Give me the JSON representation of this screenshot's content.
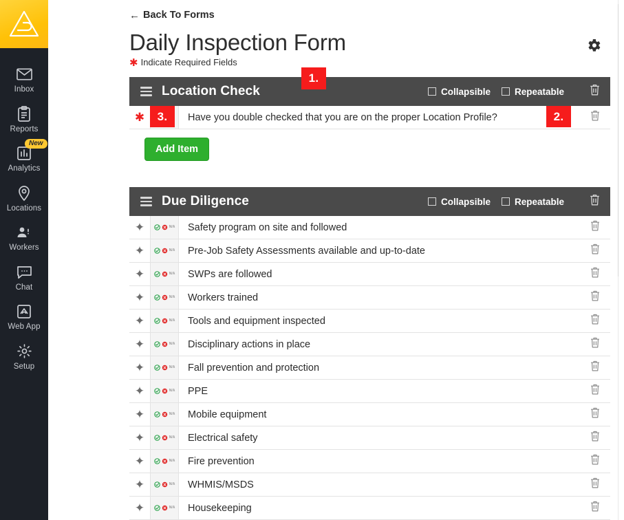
{
  "sidebar": {
    "logo_name": "brand-logo",
    "items": [
      {
        "label": "Inbox",
        "icon": "envelope-icon",
        "badge": null
      },
      {
        "label": "Reports",
        "icon": "clipboard-icon",
        "badge": null
      },
      {
        "label": "Analytics",
        "icon": "bar-chart-icon",
        "badge": "New"
      },
      {
        "label": "Locations",
        "icon": "map-pin-icon",
        "badge": null
      },
      {
        "label": "Workers",
        "icon": "people-icon",
        "badge": null
      },
      {
        "label": "Chat",
        "icon": "chat-bubble-icon",
        "badge": null
      },
      {
        "label": "Web App",
        "icon": "web-app-icon",
        "badge": null
      },
      {
        "label": "Setup",
        "icon": "gear-icon",
        "badge": null
      }
    ]
  },
  "header": {
    "back_label": "Back To Forms",
    "title": "Daily Inspection Form",
    "required_note": "Indicate Required Fields",
    "required_star": "✱",
    "settings_icon": "gear-icon"
  },
  "common": {
    "collapsible_label": "Collapsible",
    "repeatable_label": "Repeatable",
    "yes_label": "Yes",
    "no_label": "No",
    "na_label": "N/A",
    "add_item_label": "Add Item"
  },
  "sections": [
    {
      "title": "Location Check",
      "collapsible_checked": false,
      "repeatable_checked": false,
      "items": [
        {
          "label": "Have you double checked that you are on the proper Location Profile?",
          "required": true,
          "answer_type": "yes-no-na-text"
        }
      ],
      "show_add_item": true
    },
    {
      "title": "Due Diligence",
      "collapsible_checked": false,
      "repeatable_checked": false,
      "items": [
        {
          "label": "Safety program on site and followed",
          "required": false,
          "answer_type": "yes-no-na-icon"
        },
        {
          "label": "Pre-Job Safety Assessments available and up-to-date",
          "required": false,
          "answer_type": "yes-no-na-icon"
        },
        {
          "label": "SWPs are followed",
          "required": false,
          "answer_type": "yes-no-na-icon"
        },
        {
          "label": "Workers trained",
          "required": false,
          "answer_type": "yes-no-na-icon"
        },
        {
          "label": "Tools and equipment inspected",
          "required": false,
          "answer_type": "yes-no-na-icon"
        },
        {
          "label": "Disciplinary actions in place",
          "required": false,
          "answer_type": "yes-no-na-icon"
        },
        {
          "label": "Fall prevention and protection",
          "required": false,
          "answer_type": "yes-no-na-icon"
        },
        {
          "label": "PPE",
          "required": false,
          "answer_type": "yes-no-na-icon"
        },
        {
          "label": "Mobile equipment",
          "required": false,
          "answer_type": "yes-no-na-icon"
        },
        {
          "label": "Electrical safety",
          "required": false,
          "answer_type": "yes-no-na-icon"
        },
        {
          "label": "Fire prevention",
          "required": false,
          "answer_type": "yes-no-na-icon"
        },
        {
          "label": "WHMIS/MSDS",
          "required": false,
          "answer_type": "yes-no-na-icon"
        },
        {
          "label": "Housekeeping",
          "required": false,
          "answer_type": "yes-no-na-icon"
        }
      ],
      "show_add_item": false
    }
  ],
  "annotations": [
    {
      "id": "1",
      "text": "1."
    },
    {
      "id": "2",
      "text": "2."
    },
    {
      "id": "3",
      "text": "3."
    }
  ],
  "colors": {
    "brand_yellow": "#ffc107",
    "sidebar_bg": "#1d2128",
    "section_header_bg": "#4a4a4a",
    "required_red": "#ee2222",
    "annotation_red": "#f61c1c",
    "add_button_green": "#2eaf2e"
  }
}
